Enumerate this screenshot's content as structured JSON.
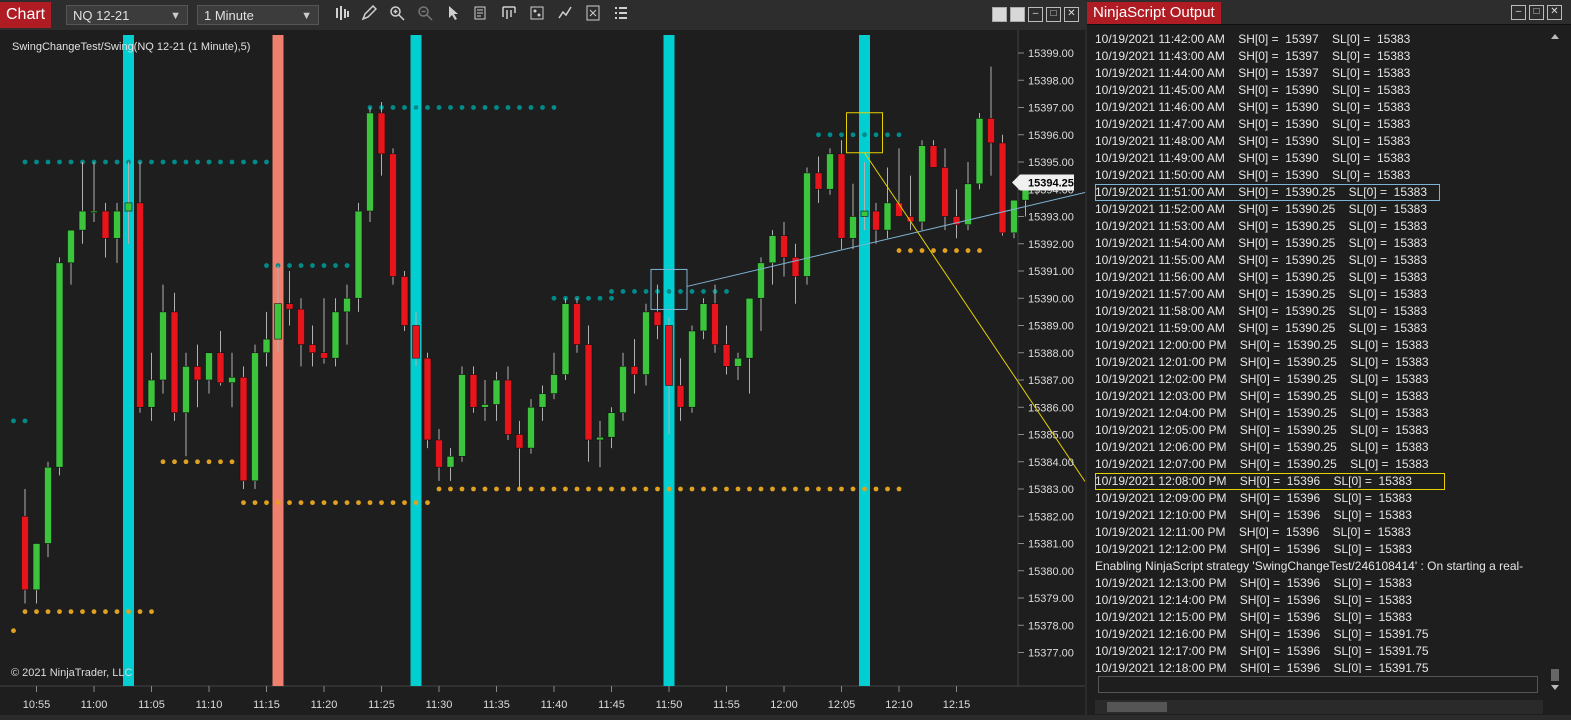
{
  "chart_window": {
    "title": "Chart",
    "instrument": "NQ 12-21",
    "interval": "1 Minute",
    "series_label": "SwingChangeTest/Swing(NQ 12-21 (1 Minute),5)",
    "copyright": "© 2021 NinjaTrader, LLC",
    "current_price": "15394.25",
    "toolbar_icons": [
      "bar-type-icon",
      "pencil-icon",
      "zoom-in-icon",
      "zoom-out-icon",
      "pointer-icon",
      "data-box-icon",
      "properties-icon",
      "strategies-icon",
      "chart-trader-icon",
      "menu-icon"
    ]
  },
  "chart_data": {
    "type": "candlestick",
    "ylim": [
      15376.5,
      15399.5
    ],
    "y_ticks": [
      "15377.00",
      "15378.00",
      "15379.00",
      "15380.00",
      "15381.00",
      "15382.00",
      "15383.00",
      "15384.00",
      "15385.00",
      "15386.00",
      "15387.00",
      "15388.00",
      "15389.00",
      "15390.00",
      "15391.00",
      "15392.00",
      "15393.00",
      "15394.00",
      "15395.00",
      "15396.00",
      "15397.00",
      "15398.00",
      "15399.00"
    ],
    "x_ticks": [
      "10:55",
      "11:00",
      "11:05",
      "11:10",
      "11:15",
      "11:20",
      "11:25",
      "11:30",
      "11:35",
      "11:40",
      "11:45",
      "11:50",
      "11:55",
      "12:00",
      "12:05",
      "12:10",
      "12:15"
    ],
    "x_tick_index": [
      1,
      6,
      11,
      16,
      21,
      26,
      31,
      36,
      41,
      46,
      51,
      56,
      61,
      66,
      71,
      76,
      81
    ],
    "colors": {
      "up": "#3cc43c",
      "down": "#e8141c",
      "highlight": "#00ced1",
      "highlight_red": "#f0806e",
      "swing_high": "#008b8b",
      "swing_low": "#e0a020"
    },
    "candles": [
      [
        15382,
        15383,
        15378.8,
        15379.3
      ],
      [
        15379.3,
        15381,
        15378.8,
        15381
      ],
      [
        15381,
        15384,
        15380.5,
        15383.8
      ],
      [
        15383.8,
        15391.5,
        15383.5,
        15391.3
      ],
      [
        15391.3,
        15392.5,
        15390.5,
        15392.5
      ],
      [
        15392.5,
        15395,
        15392,
        15393.2
      ],
      [
        15393.2,
        15395,
        15392.8,
        15393.2
      ],
      [
        15393.2,
        15393.5,
        15391.5,
        15392.2
      ],
      [
        15392.2,
        15393.5,
        15391.3,
        15393.2
      ],
      [
        15393.2,
        15395,
        15392,
        15393.5
      ],
      [
        15393.5,
        15395,
        15385.8,
        15386
      ],
      [
        15386,
        15388,
        15385.5,
        15387
      ],
      [
        15387,
        15390.5,
        15386.5,
        15389.5
      ],
      [
        15389.5,
        15390.2,
        15385.5,
        15385.8
      ],
      [
        15385.8,
        15388,
        15384.2,
        15387.5
      ],
      [
        15387.5,
        15388.3,
        15386,
        15387
      ],
      [
        15387,
        15388,
        15386.5,
        15388
      ],
      [
        15388,
        15388.8,
        15386.8,
        15386.9
      ],
      [
        15386.9,
        15388,
        15386,
        15387.1
      ],
      [
        15387.1,
        15387.5,
        15383,
        15383.3
      ],
      [
        15383.3,
        15388.3,
        15383,
        15388
      ],
      [
        15388,
        15389.5,
        15387.5,
        15388.5
      ],
      [
        15388.5,
        15391.2,
        15388,
        15389.8
      ],
      [
        15389.8,
        15391,
        15389,
        15389.6
      ],
      [
        15389.6,
        15390,
        15387.5,
        15388.3
      ],
      [
        15388.3,
        15389,
        15387.5,
        15388
      ],
      [
        15388,
        15390,
        15387.6,
        15387.8
      ],
      [
        15387.8,
        15390,
        15387.5,
        15389.5
      ],
      [
        15389.5,
        15390.5,
        15388.3,
        15390
      ],
      [
        15390,
        15393.5,
        15389.5,
        15393.2
      ],
      [
        15393.2,
        15397,
        15392.8,
        15396.8
      ],
      [
        15396.8,
        15397.2,
        15394.5,
        15395.3
      ],
      [
        15395.3,
        15395.5,
        15390.5,
        15390.8
      ],
      [
        15390.8,
        15391,
        15388.8,
        15389
      ],
      [
        15389,
        15389.5,
        15387.5,
        15387.8
      ],
      [
        15387.8,
        15388,
        15384.5,
        15384.8
      ],
      [
        15384.8,
        15385.2,
        15383.3,
        15383.8
      ],
      [
        15383.8,
        15384.5,
        15383.3,
        15384.2
      ],
      [
        15384.2,
        15387.5,
        15384,
        15387.2
      ],
      [
        15387.2,
        15387.5,
        15385.8,
        15386
      ],
      [
        15386,
        15387,
        15385.5,
        15386.1
      ],
      [
        15386.1,
        15387.3,
        15385.5,
        15387
      ],
      [
        15387,
        15387.5,
        15384.8,
        15385
      ],
      [
        15385,
        15385.5,
        15383,
        15384.5
      ],
      [
        15384.5,
        15386.3,
        15384.3,
        15386
      ],
      [
        15386,
        15386.8,
        15385.5,
        15386.5
      ],
      [
        15386.5,
        15388,
        15386.3,
        15387.2
      ],
      [
        15387.2,
        15390,
        15387,
        15389.8
      ],
      [
        15389.8,
        15390,
        15388,
        15388.3
      ],
      [
        15388.3,
        15389,
        15384,
        15384.8
      ],
      [
        15384.8,
        15385.5,
        15383.8,
        15384.9
      ],
      [
        15384.9,
        15386,
        15384.5,
        15385.8
      ],
      [
        15385.8,
        15388,
        15385.5,
        15387.5
      ],
      [
        15387.5,
        15388.5,
        15386.5,
        15387.2
      ],
      [
        15387.2,
        15389.8,
        15386.8,
        15389.5
      ],
      [
        15389.5,
        15390.5,
        15388.5,
        15389
      ],
      [
        15389,
        15389.3,
        15385,
        15386.8
      ],
      [
        15386.8,
        15387.8,
        15385.5,
        15386
      ],
      [
        15386,
        15389,
        15385.8,
        15388.8
      ],
      [
        15388.8,
        15390,
        15388.5,
        15389.8
      ],
      [
        15389.8,
        15390.5,
        15388,
        15388.3
      ],
      [
        15388.3,
        15389,
        15387.2,
        15387.5
      ],
      [
        15387.5,
        15388,
        15387,
        15387.8
      ],
      [
        15387.8,
        15390,
        15386.5,
        15390
      ],
      [
        15390,
        15391.5,
        15388.8,
        15391.3
      ],
      [
        15391.3,
        15392.5,
        15390.5,
        15392.3
      ],
      [
        15392.3,
        15392.8,
        15390.8,
        15391.5
      ],
      [
        15391.5,
        15392,
        15389.8,
        15390.8
      ],
      [
        15390.8,
        15394.8,
        15390.5,
        15394.6
      ],
      [
        15394.6,
        15395.2,
        15393.5,
        15394
      ],
      [
        15394,
        15395.5,
        15393.8,
        15395.3
      ],
      [
        15395.3,
        15395.8,
        15391.8,
        15392.2
      ],
      [
        15392.2,
        15394.2,
        15391.8,
        15393
      ],
      [
        15393,
        15395,
        15392.5,
        15393.2
      ],
      [
        15393.2,
        15393.5,
        15392,
        15392.5
      ],
      [
        15392.5,
        15394.8,
        15392.2,
        15393.5
      ],
      [
        15393.5,
        15395.5,
        15393,
        15393
      ],
      [
        15393,
        15394.5,
        15392.5,
        15392.8
      ],
      [
        15392.8,
        15395.8,
        15392.5,
        15395.6
      ],
      [
        15395.6,
        15395.8,
        15394.8,
        15394.8
      ],
      [
        15394.8,
        15395.5,
        15392.5,
        15393
      ],
      [
        15393,
        15394,
        15392.2,
        15392.7
      ],
      [
        15392.7,
        15395,
        15392.5,
        15394.2
      ],
      [
        15394.2,
        15396.8,
        15394,
        15396.6
      ],
      [
        15396.6,
        15398.5,
        15394.5,
        15395.7
      ],
      [
        15395.7,
        15396,
        15392.3,
        15392.4
      ],
      [
        15392.4,
        15393.5,
        15392.2,
        15393.6
      ],
      [
        15393.6,
        15394.3,
        15393,
        15394.2
      ],
      [
        15394.2,
        15394.5,
        15393.8,
        15394.25
      ]
    ],
    "highlight_bars": [
      {
        "index": 9,
        "color": "cyan"
      },
      {
        "index": 22,
        "color": "red"
      },
      {
        "index": 34,
        "color": "cyan"
      },
      {
        "index": 56,
        "color": "cyan"
      },
      {
        "index": 73,
        "color": "cyan"
      }
    ],
    "swing_high_segments": [
      {
        "from": -1,
        "to": 0,
        "value": 15385.5
      },
      {
        "from": 0,
        "to": 21,
        "value": 15395
      },
      {
        "from": 21,
        "to": 29,
        "value": 15391.2
      },
      {
        "from": 30,
        "to": 46,
        "value": 15397
      },
      {
        "from": 46,
        "to": 51,
        "value": 15390
      },
      {
        "from": 51,
        "to": 61,
        "value": 15390.25
      },
      {
        "from": 69,
        "to": 76,
        "value": 15396
      }
    ],
    "swing_low_segments": [
      {
        "from": -1,
        "to": -1,
        "value": 15377.8
      },
      {
        "from": 0,
        "to": 11,
        "value": 15378.5
      },
      {
        "from": 12,
        "to": 18,
        "value": 15384
      },
      {
        "from": 19,
        "to": 35,
        "value": 15382.5
      },
      {
        "from": 36,
        "to": 76,
        "value": 15383
      },
      {
        "from": 76,
        "to": 83,
        "value": 15391.75
      }
    ],
    "highlight_boxes": [
      {
        "index": 56,
        "value": 15390.25,
        "color": "#7fb3d5",
        "target_line": "11:51"
      },
      {
        "index": 73,
        "value": 15396,
        "color": "#e6d200",
        "target_line": "12:08"
      }
    ]
  },
  "output_window": {
    "title": "NinjaScript Output",
    "lines": [
      {
        "text": "10/19/2021 11:42:00 AM    SH[0] =  15397    SL[0] =  15383",
        "box": ""
      },
      {
        "text": "10/19/2021 11:43:00 AM    SH[0] =  15397    SL[0] =  15383",
        "box": ""
      },
      {
        "text": "10/19/2021 11:44:00 AM    SH[0] =  15397    SL[0] =  15383",
        "box": ""
      },
      {
        "text": "10/19/2021 11:45:00 AM    SH[0] =  15390    SL[0] =  15383",
        "box": ""
      },
      {
        "text": "10/19/2021 11:46:00 AM    SH[0] =  15390    SL[0] =  15383",
        "box": ""
      },
      {
        "text": "10/19/2021 11:47:00 AM    SH[0] =  15390    SL[0] =  15383",
        "box": ""
      },
      {
        "text": "10/19/2021 11:48:00 AM    SH[0] =  15390    SL[0] =  15383",
        "box": ""
      },
      {
        "text": "10/19/2021 11:49:00 AM    SH[0] =  15390    SL[0] =  15383",
        "box": ""
      },
      {
        "text": "10/19/2021 11:50:00 AM    SH[0] =  15390    SL[0] =  15383",
        "box": ""
      },
      {
        "text": "10/19/2021 11:51:00 AM    SH[0] =  15390.25    SL[0] =  15383",
        "box": "blue"
      },
      {
        "text": "10/19/2021 11:52:00 AM    SH[0] =  15390.25    SL[0] =  15383",
        "box": ""
      },
      {
        "text": "10/19/2021 11:53:00 AM    SH[0] =  15390.25    SL[0] =  15383",
        "box": ""
      },
      {
        "text": "10/19/2021 11:54:00 AM    SH[0] =  15390.25    SL[0] =  15383",
        "box": ""
      },
      {
        "text": "10/19/2021 11:55:00 AM    SH[0] =  15390.25    SL[0] =  15383",
        "box": ""
      },
      {
        "text": "10/19/2021 11:56:00 AM    SH[0] =  15390.25    SL[0] =  15383",
        "box": ""
      },
      {
        "text": "10/19/2021 11:57:00 AM    SH[0] =  15390.25    SL[0] =  15383",
        "box": ""
      },
      {
        "text": "10/19/2021 11:58:00 AM    SH[0] =  15390.25    SL[0] =  15383",
        "box": ""
      },
      {
        "text": "10/19/2021 11:59:00 AM    SH[0] =  15390.25    SL[0] =  15383",
        "box": ""
      },
      {
        "text": "10/19/2021 12:00:00 PM    SH[0] =  15390.25    SL[0] =  15383",
        "box": ""
      },
      {
        "text": "10/19/2021 12:01:00 PM    SH[0] =  15390.25    SL[0] =  15383",
        "box": ""
      },
      {
        "text": "10/19/2021 12:02:00 PM    SH[0] =  15390.25    SL[0] =  15383",
        "box": ""
      },
      {
        "text": "10/19/2021 12:03:00 PM    SH[0] =  15390.25    SL[0] =  15383",
        "box": ""
      },
      {
        "text": "10/19/2021 12:04:00 PM    SH[0] =  15390.25    SL[0] =  15383",
        "box": ""
      },
      {
        "text": "10/19/2021 12:05:00 PM    SH[0] =  15390.25    SL[0] =  15383",
        "box": ""
      },
      {
        "text": "10/19/2021 12:06:00 PM    SH[0] =  15390.25    SL[0] =  15383",
        "box": ""
      },
      {
        "text": "10/19/2021 12:07:00 PM    SH[0] =  15390.25    SL[0] =  15383",
        "box": ""
      },
      {
        "text": "10/19/2021 12:08:00 PM    SH[0] =  15396    SL[0] =  15383",
        "box": "yellow"
      },
      {
        "text": "10/19/2021 12:09:00 PM    SH[0] =  15396    SL[0] =  15383",
        "box": ""
      },
      {
        "text": "10/19/2021 12:10:00 PM    SH[0] =  15396    SL[0] =  15383",
        "box": ""
      },
      {
        "text": "10/19/2021 12:11:00 PM    SH[0] =  15396    SL[0] =  15383",
        "box": ""
      },
      {
        "text": "10/19/2021 12:12:00 PM    SH[0] =  15396    SL[0] =  15383",
        "box": ""
      },
      {
        "text": "Enabling NinjaScript strategy 'SwingChangeTest/246108414' : On starting a real-",
        "box": ""
      },
      {
        "text": "10/19/2021 12:13:00 PM    SH[0] =  15396    SL[0] =  15383",
        "box": ""
      },
      {
        "text": "10/19/2021 12:14:00 PM    SH[0] =  15396    SL[0] =  15383",
        "box": ""
      },
      {
        "text": "10/19/2021 12:15:00 PM    SH[0] =  15396    SL[0] =  15383",
        "box": ""
      },
      {
        "text": "10/19/2021 12:16:00 PM    SH[0] =  15396    SL[0] =  15391.75",
        "box": ""
      },
      {
        "text": "10/19/2021 12:17:00 PM    SH[0] =  15396    SL[0] =  15391.75",
        "box": ""
      },
      {
        "text": "10/19/2021 12:18:00 PM    SH[0] =  15396    SL[0] =  15391.75",
        "box": ""
      }
    ]
  }
}
